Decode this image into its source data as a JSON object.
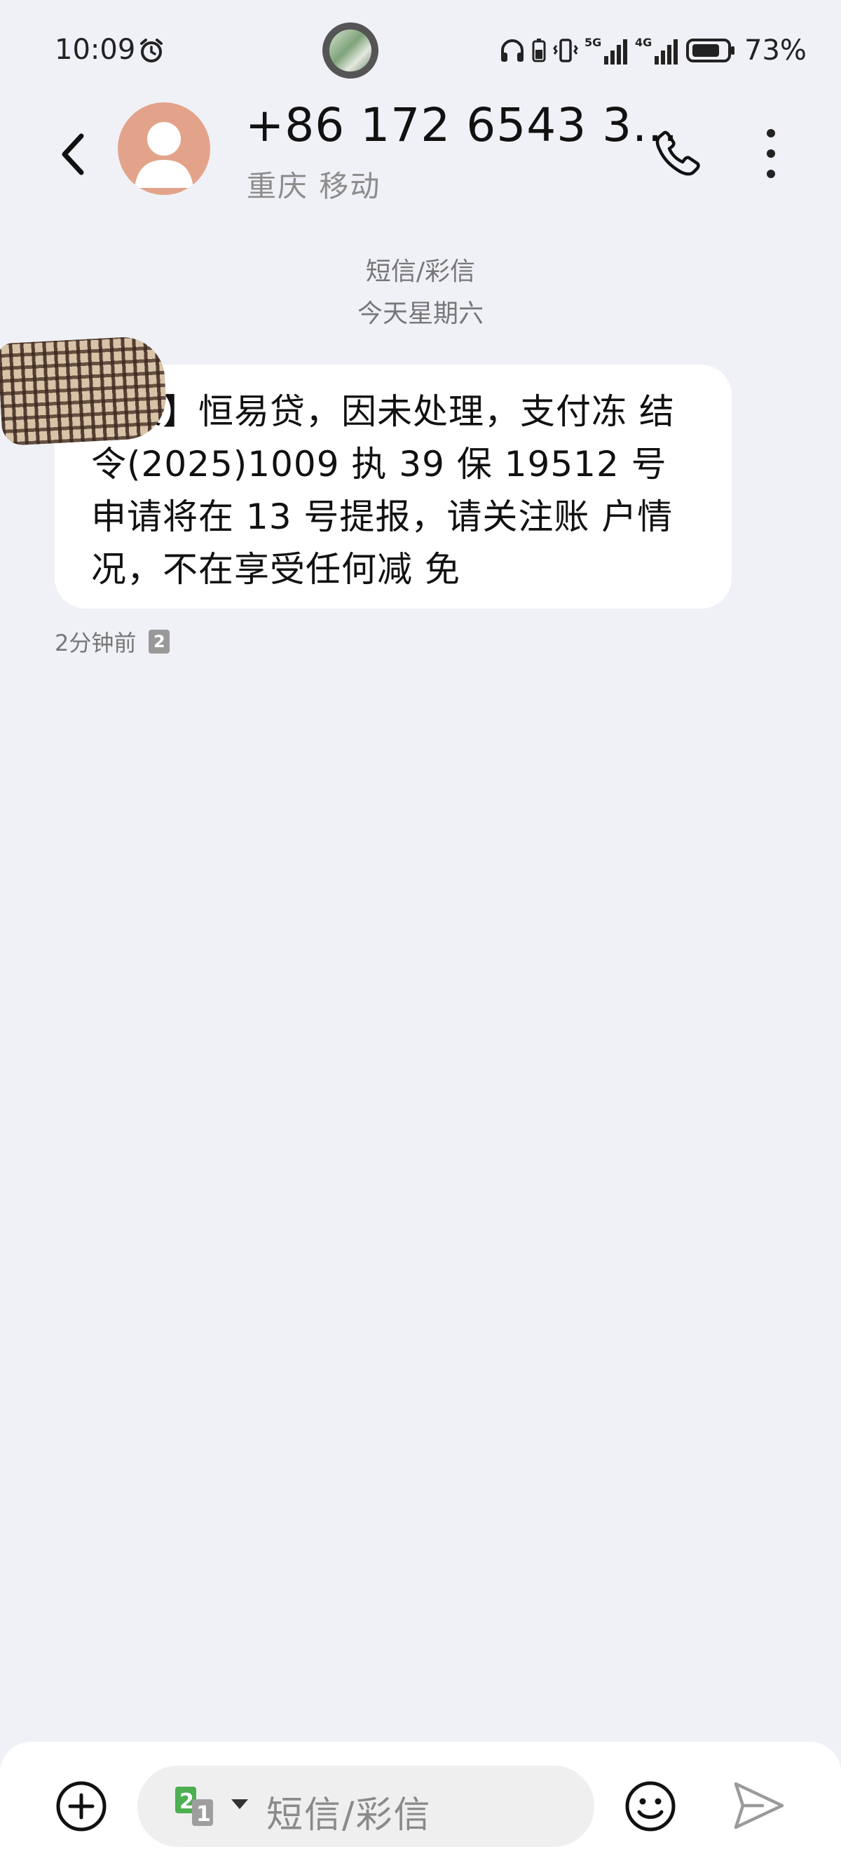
{
  "status_bar": {
    "time": "10:09",
    "battery_percent": "73%",
    "network_labels": [
      "5G",
      "4G"
    ]
  },
  "header": {
    "contact_name": "+86 172 6543 3...",
    "contact_location": "重庆 移动"
  },
  "conversation": {
    "message_type": "短信/彩信",
    "date": "今天星期六",
    "messages": [
      {
        "text": "【某】恒易贷，因未处理，支付冻 结令(2025)1009 执 39 保 19512 号 申请将在 13 号提报，请关注账 户情况，不在享受任何减 免",
        "time": "2分钟前",
        "sim": "2"
      }
    ]
  },
  "input_bar": {
    "placeholder": "短信/彩信",
    "sim_primary": "2",
    "sim_secondary": "1"
  },
  "colors": {
    "background": "#f0f1f7",
    "avatar": "#e3a38a",
    "sim_green": "#4caf50"
  },
  "icons": [
    "alarm-icon",
    "headphones-icon",
    "vibrate-icon",
    "signal-icon",
    "battery-icon",
    "back-icon",
    "phone-icon",
    "more-icon",
    "add-icon",
    "emoji-icon",
    "send-icon"
  ]
}
